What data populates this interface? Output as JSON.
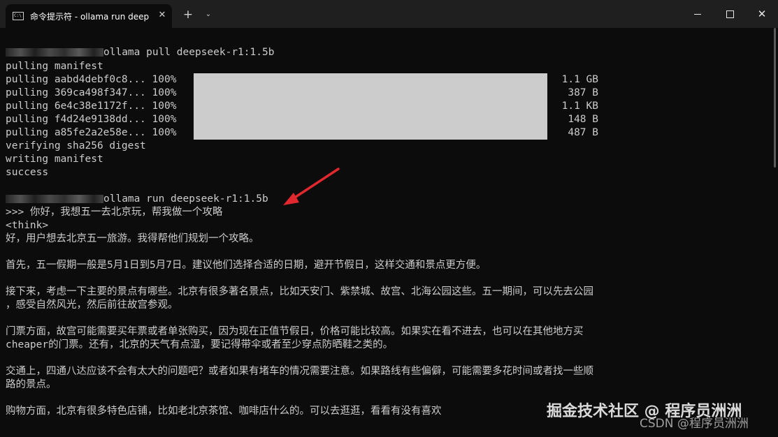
{
  "window": {
    "tab_title": "命令提示符 - ollama  run deep",
    "tab_icon_text": "C:\\",
    "new_tab": "+",
    "dropdown": "⌄",
    "close_tab": "✕",
    "close_window": "✕"
  },
  "terminal": {
    "pull_cmd": "ollama pull deepseek-r1:1.5b",
    "pulling_manifest": "pulling manifest",
    "pull_rows": [
      {
        "label": "pulling aabd4debf0c8... 100%",
        "size": "1.1 GB"
      },
      {
        "label": "pulling 369ca498f347... 100%",
        "size": "387 B"
      },
      {
        "label": "pulling 6e4c38e1172f... 100%",
        "size": "1.1 KB"
      },
      {
        "label": "pulling f4d24e9138dd... 100%",
        "size": "148 B"
      },
      {
        "label": "pulling a85fe2a2e58e... 100%",
        "size": "487 B"
      }
    ],
    "progress_fraction": 1.0,
    "verifying": "verifying sha256 digest",
    "writing": "writing manifest",
    "success": "success",
    "run_cmd": "ollama run deepseek-r1:1.5b",
    "prompt": ">>> 你好，我想五一去北京玩，帮我做一个攻略",
    "think": "<think>",
    "l1": "好，用户想去北京五一旅游。我得帮他们规划一个攻略。",
    "l2": "首先，五一假期一般是5月1日到5月7日。建议他们选择合适的日期，避开节假日，这样交通和景点更方便。",
    "l3a": "接下来，考虑一下主要的景点有哪些。北京有很多著名景点，比如天安门、紫禁城、故宫、北海公园这些。五一期间，可以先去公园",
    "l3b": "，感受自然风光，然后前往故宫参观。",
    "l4a": "门票方面，故宫可能需要买年票或者单张购买，因为现在正值节假日，价格可能比较高。如果实在看不进去，也可以在其他地方买",
    "l4b": "cheaper的门票。还有，北京的天气有点湿，要记得带伞或者至少穿点防晒鞋之类的。",
    "l5a": "交通上，四通八达应该不会有太大的问题吧？或者如果有堵车的情况需要注意。如果路线有些偏僻，可能需要多花时间或者找一些顺",
    "l5b": "路的景点。",
    "l6": "购物方面，北京有很多特色店铺，比如老北京茶馆、咖啡店什么的。可以去逛逛，看看有没有喜欢"
  },
  "watermark": {
    "juejin": "掘金技术社区 @ 程序员洲洲",
    "csdn": "CSDN @程序员洲洲"
  },
  "colors": {
    "bg": "#0c0c0c",
    "text": "#cccccc",
    "progress": "#cccccc",
    "titlebar": "#1f1f1f",
    "arrow": "#e0282e"
  }
}
